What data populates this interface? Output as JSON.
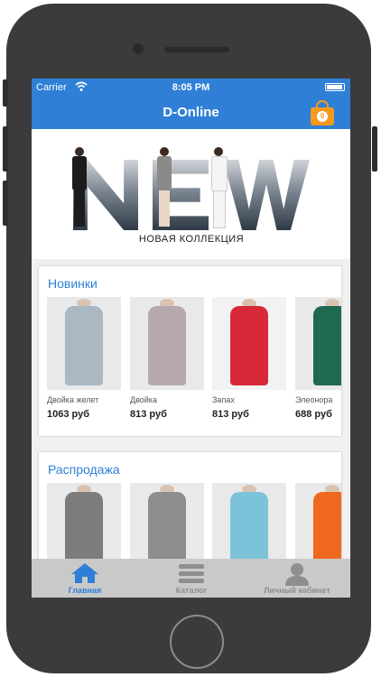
{
  "status_bar": {
    "carrier": "Carrier",
    "time": "8:05 PM"
  },
  "nav": {
    "title": "D-Online",
    "cart_count": "0"
  },
  "banner": {
    "headline": "NEW",
    "subtitle": "НОВАЯ КОЛЛЕКЦИЯ"
  },
  "sections": [
    {
      "title": "Новинки",
      "items": [
        {
          "name": "Двойка желет",
          "price": "1063 руб",
          "color": "#a9b8c3"
        },
        {
          "name": "Двойка",
          "price": "813 руб",
          "color": "#b5a9ae"
        },
        {
          "name": "Запах",
          "price": "813 руб",
          "color": "#d8293a"
        },
        {
          "name": "Элеонора",
          "price": "688 руб",
          "color": "#1f6a4f"
        }
      ]
    },
    {
      "title": "Распродажа",
      "items": [
        {
          "name": "",
          "price": "",
          "color": "#7c7c7c"
        },
        {
          "name": "",
          "price": "",
          "color": "#8d8d8d"
        },
        {
          "name": "",
          "price": "",
          "color": "#7cc3d9"
        },
        {
          "name": "",
          "price": "",
          "color": "#ef6a1f"
        }
      ]
    }
  ],
  "tabbar": {
    "items": [
      {
        "label": "Главная",
        "icon": "home-icon",
        "active": true
      },
      {
        "label": "Каталог",
        "icon": "menu-icon",
        "active": false
      },
      {
        "label": "Личный кабинет",
        "icon": "user-icon",
        "active": false
      }
    ]
  },
  "colors": {
    "accent": "#2f7fd6",
    "cart": "#f59a1f",
    "tab_active": "#2f7fd6",
    "tab_inactive": "#8e8e8e",
    "tabbar_bg": "#c9c9c9"
  }
}
